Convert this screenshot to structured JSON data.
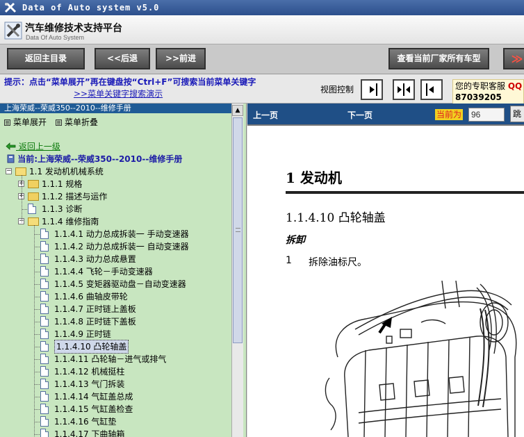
{
  "window": {
    "title": "Data of Auto system v5.0"
  },
  "brand": {
    "name": "汽车维修技术支持平台",
    "subtitle": "Data Of Auto System"
  },
  "toolbar": {
    "home": "返回主目录",
    "back": "<<后退",
    "forward": ">>前进",
    "all_models": "查看当前厂家所有车型",
    "more": "≫"
  },
  "hint": {
    "text": "提示：点击“菜单展开”再在键盘按“Ctrl+F”可搜索当前菜单关键字",
    "link": ">>菜单关键字搜索演示",
    "view_control": "视图控制"
  },
  "service": {
    "label": "您的专职客服",
    "qq": "QQ",
    "number": "87039205"
  },
  "left": {
    "header": "上海荣威--荣威350--2010--维修手册",
    "expand": "菜单展开",
    "collapse": "菜单折叠",
    "back": "返回上一级",
    "current": "当前:上海荣威--荣威350--2010--维修手册"
  },
  "tree": [
    {
      "level": 0,
      "kind": "folder-open",
      "toggle": "−",
      "label": "1.1 发动机机械系统"
    },
    {
      "level": 1,
      "kind": "folder",
      "toggle": "+",
      "label": "1.1.1 规格"
    },
    {
      "level": 1,
      "kind": "folder",
      "toggle": "+",
      "label": "1.1.2 描述与运作"
    },
    {
      "level": 1,
      "kind": "doc",
      "toggle": "",
      "label": "1.1.3 诊断"
    },
    {
      "level": 1,
      "kind": "folder-open",
      "toggle": "−",
      "label": "1.1.4 维修指南"
    },
    {
      "level": 2,
      "kind": "doc",
      "toggle": "",
      "label": "1.1.4.1 动力总成拆装一 手动变速器"
    },
    {
      "level": 2,
      "kind": "doc",
      "toggle": "",
      "label": "1.1.4.2 动力总成拆装一 自动变速器"
    },
    {
      "level": 2,
      "kind": "doc",
      "toggle": "",
      "label": "1.1.4.3 动力总成悬置"
    },
    {
      "level": 2,
      "kind": "doc",
      "toggle": "",
      "label": "1.1.4.4 飞轮－手动变速器"
    },
    {
      "level": 2,
      "kind": "doc",
      "toggle": "",
      "label": "1.1.4.5 变矩器驱动盘－自动变速器"
    },
    {
      "level": 2,
      "kind": "doc",
      "toggle": "",
      "label": "1.1.4.6 曲轴皮带轮"
    },
    {
      "level": 2,
      "kind": "doc",
      "toggle": "",
      "label": "1.1.4.7 正时链上盖板"
    },
    {
      "level": 2,
      "kind": "doc",
      "toggle": "",
      "label": "1.1.4.8 正时链下盖板"
    },
    {
      "level": 2,
      "kind": "doc",
      "toggle": "",
      "label": "1.1.4.9 正时链"
    },
    {
      "level": 2,
      "kind": "doc",
      "toggle": "",
      "label": "1.1.4.10 凸轮轴盖",
      "selected": true
    },
    {
      "level": 2,
      "kind": "doc",
      "toggle": "",
      "label": "1.1.4.11 凸轮轴－进气或排气"
    },
    {
      "level": 2,
      "kind": "doc",
      "toggle": "",
      "label": "1.1.4.12 机械挺柱"
    },
    {
      "level": 2,
      "kind": "doc",
      "toggle": "",
      "label": "1.1.4.13 气门拆装"
    },
    {
      "level": 2,
      "kind": "doc",
      "toggle": "",
      "label": "1.1.4.14 气缸盖总成"
    },
    {
      "level": 2,
      "kind": "doc",
      "toggle": "",
      "label": "1.1.4.15 气缸盖检查"
    },
    {
      "level": 2,
      "kind": "doc",
      "toggle": "",
      "label": "1.1.4.16 气缸垫"
    },
    {
      "level": 2,
      "kind": "doc",
      "toggle": "",
      "label": "1.1.4.17 下曲轴箱"
    }
  ],
  "right": {
    "prev": "上一页",
    "next": "下一页",
    "current_label": "当前为",
    "current_page": "96",
    "jump": "跳",
    "heading1": "1 发动机",
    "heading2": "1.1.4.10 凸轮轴盖",
    "heading3": "拆卸",
    "step_num": "1",
    "step_text": "拆除油标尺。"
  },
  "colors": {
    "nav": "#1f4f86",
    "panel": "#c8e6c0",
    "hint": "#1a1ab8"
  }
}
